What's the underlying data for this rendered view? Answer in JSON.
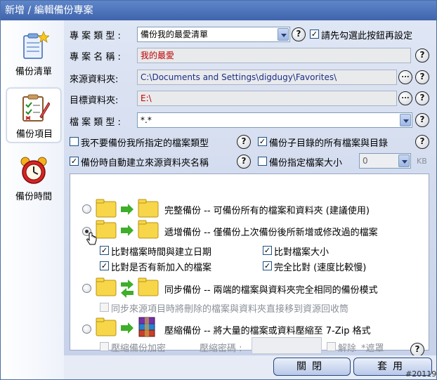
{
  "window": {
    "title": "新增 / 編輯備份專案"
  },
  "sidebar": {
    "items": [
      {
        "label": "備份清單",
        "icon": "clipboard-star-icon"
      },
      {
        "label": "備份項目",
        "icon": "checklist-pencil-icon"
      },
      {
        "label": "備份時間",
        "icon": "alarm-clock-icon"
      }
    ]
  },
  "form": {
    "project_type_label": "專 案 類 型 :",
    "project_type_value": "備份我的最愛清單",
    "check_first_label": "請先勾選此按鈕再設定",
    "project_name_label": "專 案 名 稱 :",
    "project_name_value": "我的最愛",
    "source_label": "來源資料夾:",
    "source_value": "C:\\Documents and Settings\\digdugy\\Favorites\\",
    "target_label": "目標資料夾:",
    "target_value": "E:\\",
    "file_type_label": "檔 案 類 型 :",
    "file_type_value": "*.*",
    "browse_label": "...",
    "help_label": "?"
  },
  "options": {
    "exclude_types": "我不要備份我所指定的檔案類型",
    "subdirs": "備份子目錄的所有檔案與目錄",
    "auto_create": "備份時自動建立來源資料夾名稱",
    "size_limit": "備份指定檔案大小",
    "size_value": "0",
    "size_unit": "KB"
  },
  "modes": {
    "full": "完整備份 -- 可備份所有的檔案和資料夾 (建議使用)",
    "incremental": "遞增備份 -- 僅備份上次備份後所新增或修改過的檔案",
    "inc_opt1": "比對檔案時間與建立日期",
    "inc_opt2": "比對檔案大小",
    "inc_opt3": "比對是否有新加入的檔案",
    "inc_opt4": "完全比對 (速度比較慢)",
    "sync": "同步備份 -- 兩端的檔案與資料夾完全相同的備份模式",
    "sync_opt": "同步來源項目時將刪除的檔案與資料夾直接移到資源回收筒",
    "compress": "壓縮備份 -- 將大量的檔案或資料壓縮至 7-Zip 格式",
    "encrypt": "壓縮備份加密",
    "password_label": "壓縮密碼 :",
    "unlock": "解除",
    "mask": "*遮罩"
  },
  "footer": {
    "close_label": "關閉",
    "apply_label": "套用",
    "watermark": "#20119"
  },
  "colors": {
    "titlebar": "#4a72bb",
    "main_bg": "#d3dcef",
    "accent_red": "#c00000"
  }
}
